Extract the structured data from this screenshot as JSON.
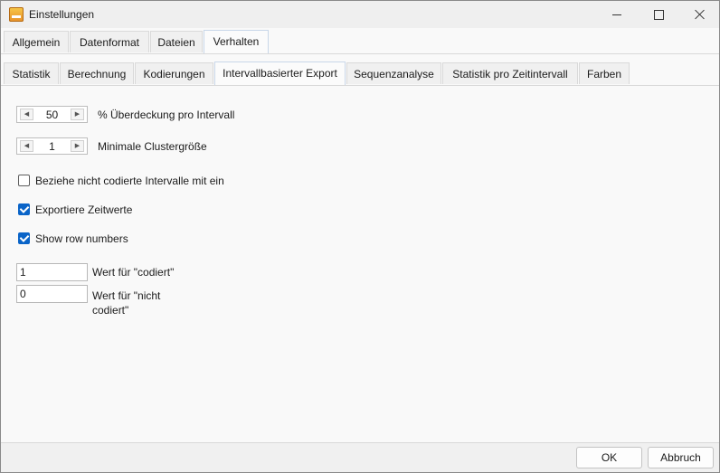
{
  "window": {
    "title": "Einstellungen"
  },
  "tabs_main": [
    "Allgemein",
    "Datenformat",
    "Dateien",
    "Verhalten"
  ],
  "tabs_sub": [
    "Statistik",
    "Berechnung",
    "Kodierungen",
    "Intervallbasierter Export",
    "Sequenzanalyse",
    "Statistik pro Zeitintervall",
    "Farben"
  ],
  "settings": {
    "overlap": {
      "value": "50",
      "label": "% Überdeckung pro Intervall"
    },
    "cluster": {
      "value": "1",
      "label": "Minimale Clustergröße"
    },
    "include_uncoded": {
      "label": "Beziehe nicht codierte Intervalle mit ein",
      "checked": false
    },
    "export_times": {
      "label": "Exportiere Zeitwerte",
      "checked": true
    },
    "row_numbers": {
      "label": "Show row numbers",
      "checked": true
    },
    "coded_value": {
      "value": "1",
      "label": "Wert für \"codiert\""
    },
    "uncoded_value": {
      "value": "0",
      "label_line1": "Wert für \"nicht",
      "label_line2": "codiert\""
    }
  },
  "buttons": {
    "ok": "OK",
    "cancel": "Abbruch"
  }
}
